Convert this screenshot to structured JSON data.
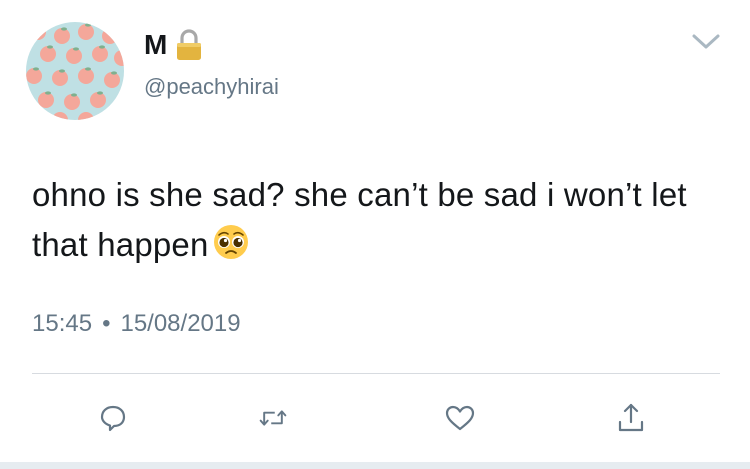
{
  "tweet": {
    "display_name": "M",
    "handle": "@peachyhirai",
    "text": "ohno is she sad? she can’t be sad i won’t let that happen",
    "time": "15:45",
    "separator": "•",
    "date": "15/08/2019"
  },
  "icons": {
    "lock": "lock-icon",
    "more": "chevron-down-icon",
    "emoji": "pleading-face-emoji",
    "reply": "reply-icon",
    "retweet": "retweet-icon",
    "like": "heart-icon",
    "share": "share-icon"
  },
  "colors": {
    "text": "#14171a",
    "secondary": "#657786",
    "divider": "#d7dbe0",
    "avatar_bg": "#bfe0e4",
    "peach": "#f4a79a"
  }
}
